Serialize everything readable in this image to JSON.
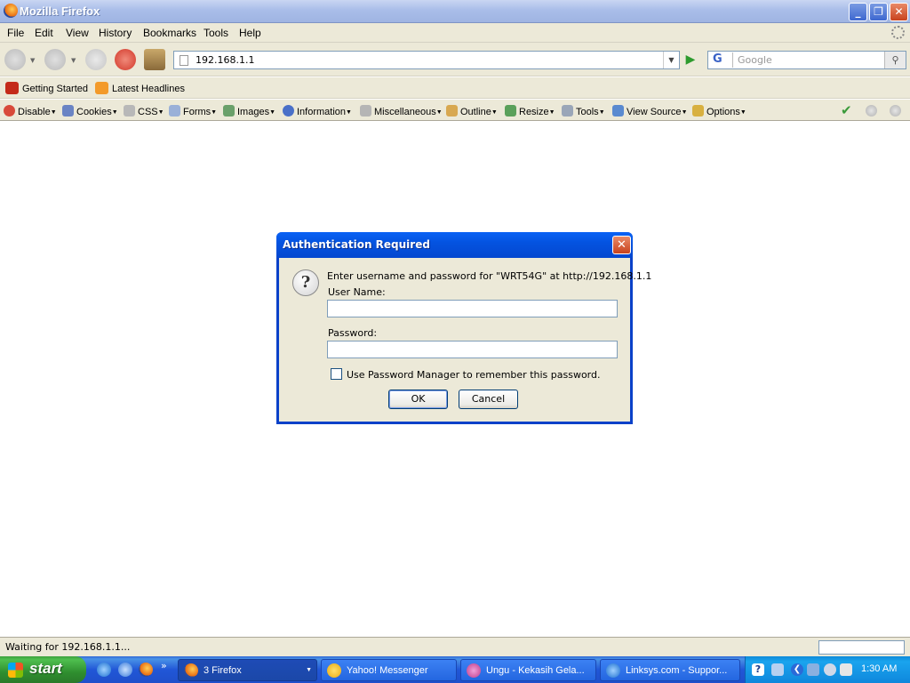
{
  "window": {
    "title": "Mozilla Firefox",
    "minimize": "_",
    "maximize": "❐",
    "close": "✕"
  },
  "menu": [
    "File",
    "Edit",
    "View",
    "History",
    "Bookmarks",
    "Tools",
    "Help"
  ],
  "nav": {
    "url": "192.168.1.1",
    "search_placeholder": "Google",
    "search_engine_glyph": "G",
    "go_glyph": "▶",
    "search_glyph": "⚲",
    "dropdown_glyph": "▼"
  },
  "bookmarks": [
    "Getting Started",
    "Latest Headlines"
  ],
  "webdev": [
    "Disable",
    "Cookies",
    "CSS",
    "Forms",
    "Images",
    "Information",
    "Miscellaneous",
    "Outline",
    "Resize",
    "Tools",
    "View Source",
    "Options"
  ],
  "webdev_arrow": "▼",
  "dialog": {
    "title": "Authentication Required",
    "close_glyph": "✕",
    "question_glyph": "?",
    "message": "Enter username and password for \"WRT54G\" at http://192.168.1.1",
    "username_label": "User Name:",
    "username_value": "",
    "password_label": "Password:",
    "password_value": "",
    "remember_label": "Use Password Manager to remember this password.",
    "ok": "OK",
    "cancel": "Cancel"
  },
  "status": {
    "text": "Waiting for 192.168.1.1..."
  },
  "taskbar": {
    "start": "start",
    "more_glyph": "»",
    "tasks": [
      {
        "label": "3 Firefox",
        "dropdown": "▼"
      },
      {
        "label": "Yahoo! Messenger"
      },
      {
        "label": "Ungu - Kekasih Gela..."
      },
      {
        "label": "Linksys.com - Suppor..."
      }
    ],
    "tray_help_glyph": "?",
    "tray_back_glyph": "❮",
    "clock": "1:30 AM"
  },
  "colors": {
    "dialog_title": "#0453e0",
    "taskbar": "#2157d7",
    "start_button": "#2f8f2f",
    "chrome_bg": "#ece9d8"
  },
  "icons": {
    "back": "back-arrow-icon",
    "forward": "forward-arrow-icon",
    "reload": "reload-icon",
    "stop": "stop-icon",
    "home": "home-icon",
    "throbber": "throbber-icon"
  }
}
